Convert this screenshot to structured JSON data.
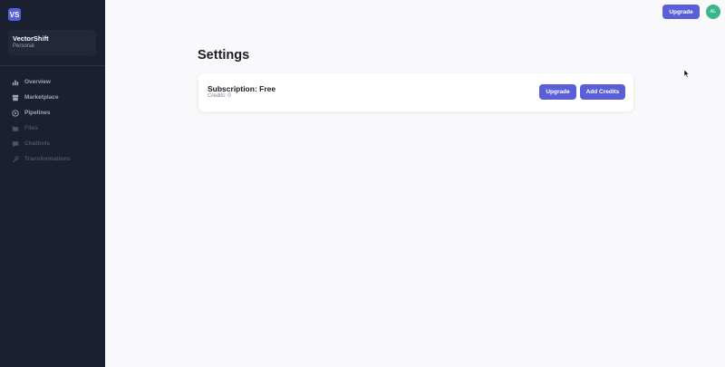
{
  "sidebar": {
    "logo_text": "VS",
    "workspace": {
      "name": "VectorShift",
      "type": "Personal"
    },
    "items": [
      {
        "label": "Overview",
        "icon": "bar-chart-icon",
        "state": "active"
      },
      {
        "label": "Marketplace",
        "icon": "store-icon",
        "state": "active"
      },
      {
        "label": "Pipelines",
        "icon": "play-circle-icon",
        "state": "active"
      },
      {
        "label": "Files",
        "icon": "folder-icon",
        "state": "disabled"
      },
      {
        "label": "Chatbots",
        "icon": "chat-icon",
        "state": "disabled"
      },
      {
        "label": "Transformations",
        "icon": "tool-icon",
        "state": "disabled"
      }
    ]
  },
  "header": {
    "upgrade_label": "Upgrade",
    "avatar_initials": "AL"
  },
  "main": {
    "title": "Settings",
    "subscription": {
      "title": "Subscription: Free",
      "credits": "Credits: 0",
      "upgrade_label": "Upgrade",
      "add_credits_label": "Add Credits"
    }
  },
  "colors": {
    "accent": "#5a5fd8",
    "sidebar_bg": "#1b2030",
    "avatar_bg": "#3bb58a",
    "page_bg": "#f9f9fb"
  }
}
